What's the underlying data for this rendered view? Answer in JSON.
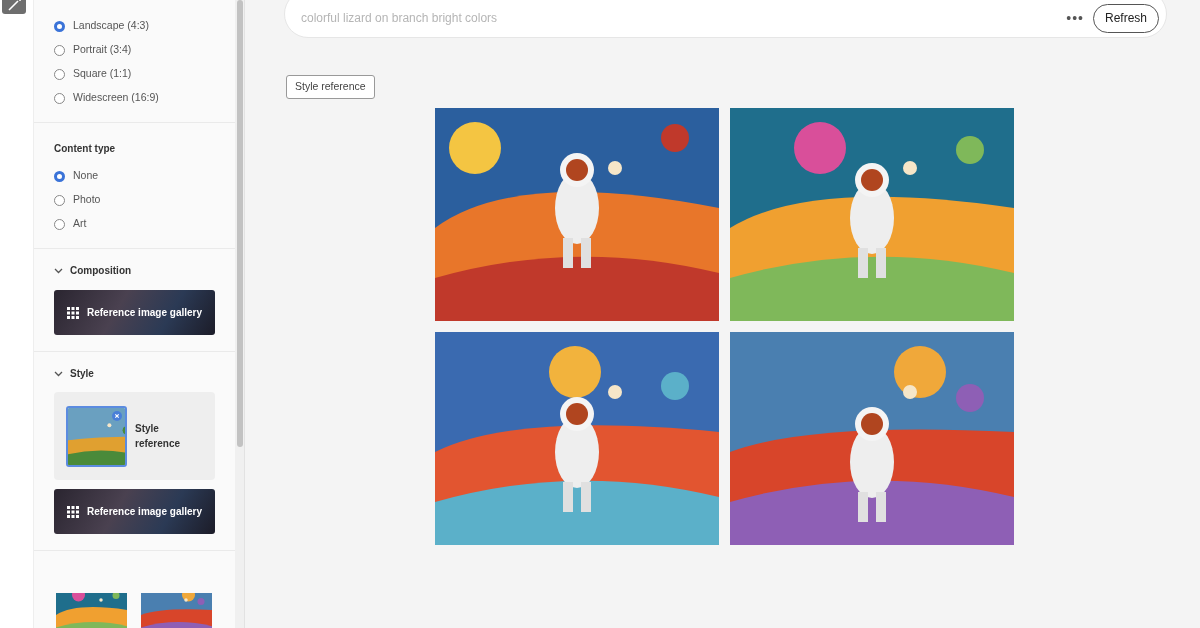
{
  "aspect_ratio": {
    "options": [
      {
        "label": "Landscape (4:3)",
        "selected": true
      },
      {
        "label": "Portrait (3:4)",
        "selected": false
      },
      {
        "label": "Square (1:1)",
        "selected": false
      },
      {
        "label": "Widescreen (16:9)",
        "selected": false
      }
    ]
  },
  "content_type": {
    "title": "Content type",
    "options": [
      {
        "label": "None",
        "selected": true
      },
      {
        "label": "Photo",
        "selected": false
      },
      {
        "label": "Art",
        "selected": false
      }
    ]
  },
  "composition": {
    "title": "Composition",
    "expanded": true,
    "gallery_button": "Reference image gallery"
  },
  "style": {
    "title": "Style",
    "expanded": true,
    "reference_label": "Style reference",
    "gallery_button": "Reference image gallery"
  },
  "prompt": {
    "placeholder": "colorful lizard on branch bright colors",
    "more": "•••",
    "refresh_button": "Refresh"
  },
  "reference_tag": "Style reference"
}
